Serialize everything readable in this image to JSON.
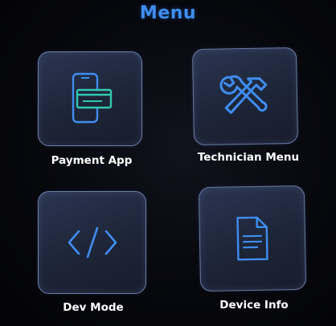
{
  "screen": {
    "title": "Menu"
  },
  "menu": {
    "items": [
      {
        "id": "payment-app",
        "label": "Payment App",
        "icon": "payment-phone-card-icon"
      },
      {
        "id": "technician-menu",
        "label": "Technician Menu",
        "icon": "wrench-hammer-icon"
      },
      {
        "id": "dev-mode",
        "label": "Dev Mode",
        "icon": "code-brackets-icon"
      },
      {
        "id": "device-info",
        "label": "Device Info",
        "icon": "document-icon"
      }
    ]
  },
  "colors": {
    "accent": "#3f8df0",
    "label": "#ffffff",
    "tile_border": "#6d7fa6",
    "background": "#07080d"
  }
}
